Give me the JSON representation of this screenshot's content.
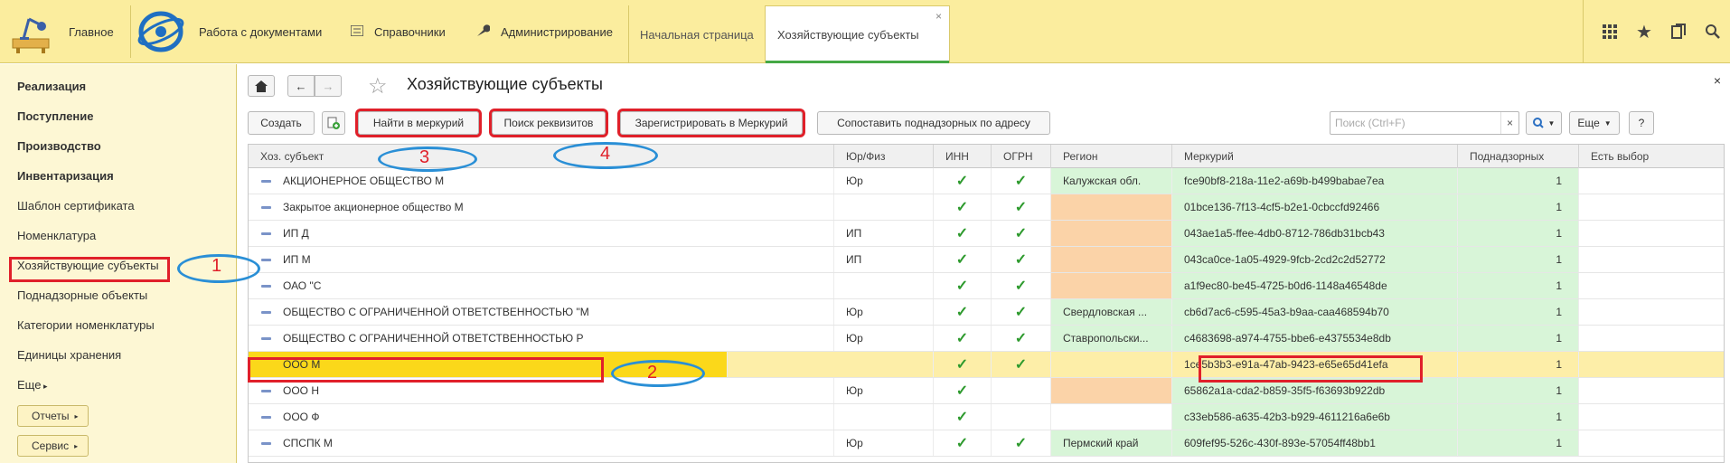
{
  "topbar": {
    "home_label": "Главное",
    "menu": [
      {
        "label": "Работа с документами",
        "icon": "none"
      },
      {
        "label": "Справочники",
        "icon": "list-icon"
      },
      {
        "label": "Администрирование",
        "icon": "wrench-icon"
      }
    ],
    "tabs": [
      {
        "label": "Начальная страница",
        "active": false
      },
      {
        "label": "Хозяйствующие субъекты",
        "active": true,
        "close": "×"
      }
    ],
    "right_icons": [
      "grid-icon",
      "star-icon",
      "history-icon",
      "search-icon"
    ]
  },
  "sidebar": {
    "items": [
      {
        "label": "Реализация",
        "bold": true
      },
      {
        "label": "Поступление",
        "bold": true
      },
      {
        "label": "Производство",
        "bold": true
      },
      {
        "label": "Инвентаризация",
        "bold": true
      },
      {
        "label": "Шаблон сертификата",
        "bold": false
      },
      {
        "label": "Номенклатура",
        "bold": false
      },
      {
        "label": "Хозяйствующие субъекты",
        "bold": false
      },
      {
        "label": "Поднадзорные объекты",
        "bold": false
      },
      {
        "label": "Категории номенклатуры",
        "bold": false
      },
      {
        "label": "Единицы хранения",
        "bold": false
      },
      {
        "label": "Еще",
        "bold": false
      }
    ],
    "buttons": [
      {
        "label": "Отчеты"
      },
      {
        "label": "Сервис"
      }
    ]
  },
  "content": {
    "title": "Хозяйствующие субъекты",
    "close": "×",
    "toolbar": {
      "create": "Создать",
      "find_mercury": "Найти в меркурий",
      "search_requisites": "Поиск реквизитов",
      "register_mercury": "Зарегистрировать в Меркурий",
      "match_supervised": "Сопоставить поднадзорных по адресу",
      "search_placeholder": "Поиск (Ctrl+F)",
      "more": "Еще",
      "help": "?"
    },
    "columns": [
      "Хоз. субъект",
      "Юр/Физ",
      "ИНН",
      "ОГРН",
      "Регион",
      "Меркурий",
      "Поднадзорных",
      "Есть выбор"
    ],
    "rows": [
      {
        "name": "АКЦИОНЕРНОЕ ОБЩЕСТВО  М",
        "type": "Юр",
        "inn": true,
        "ogrn": true,
        "region": "Калужская обл.",
        "region_color": "green",
        "mercury": "fce90bf8-218a-11e2-a69b-b499babae7ea",
        "supervised": "1"
      },
      {
        "name": "Закрытое акционерное общество  М",
        "type": "",
        "inn": true,
        "ogrn": true,
        "region": "",
        "region_color": "orange",
        "mercury": "01bce136-7f13-4cf5-b2e1-0cbccfd92466",
        "supervised": "1"
      },
      {
        "name": "ИП Д",
        "type": "ИП",
        "inn": true,
        "ogrn": true,
        "region": "",
        "region_color": "orange",
        "mercury": "043ae1a5-ffee-4db0-8712-786db31bcb43",
        "supervised": "1"
      },
      {
        "name": "ИП М",
        "type": "ИП",
        "inn": true,
        "ogrn": true,
        "region": "",
        "region_color": "orange",
        "mercury": "043ca0ce-1a05-4929-9fcb-2cd2c2d52772",
        "supervised": "1"
      },
      {
        "name": "ОАО \"С",
        "type": "",
        "inn": true,
        "ogrn": true,
        "region": "",
        "region_color": "orange",
        "mercury": "a1f9ec80-be45-4725-b0d6-1148a46548de",
        "supervised": "1"
      },
      {
        "name": "ОБЩЕСТВО С ОГРАНИЧЕННОЙ ОТВЕТСТВЕННОСТЬЮ \"М",
        "type": "Юр",
        "inn": true,
        "ogrn": true,
        "region": "Свердловская ...",
        "region_color": "green",
        "mercury": "cb6d7ac6-c595-45a3-b9aa-caa468594b70",
        "supervised": "1"
      },
      {
        "name": "ОБЩЕСТВО С ОГРАНИЧЕННОЙ ОТВЕТСТВЕННОСТЬЮ  Р",
        "type": "Юр",
        "inn": true,
        "ogrn": true,
        "region": "Ставропольски...",
        "region_color": "green",
        "mercury": "c4683698-a974-4755-bbe6-e4375534e8db",
        "supervised": "1"
      },
      {
        "name": "ООО   М",
        "type": "",
        "inn": true,
        "ogrn": true,
        "region": "",
        "region_color": "none",
        "mercury": "1ce5b3b3-e91a-47ab-9423-e65e65d41efa",
        "supervised": "1",
        "selected": true
      },
      {
        "name": "ООО  Н",
        "type": "Юр",
        "inn": true,
        "ogrn": false,
        "region": "",
        "region_color": "orange",
        "mercury": "65862a1a-cda2-b859-35f5-f63693b922db",
        "supervised": "1"
      },
      {
        "name": "ООО Ф",
        "type": "",
        "inn": true,
        "ogrn": false,
        "region": "",
        "region_color": "none",
        "mercury": "c33eb586-a635-42b3-b929-4611216a6e6b",
        "supervised": "1"
      },
      {
        "name": "СПСПК  М",
        "type": "Юр",
        "inn": true,
        "ogrn": true,
        "region": "Пермский край",
        "region_color": "green",
        "mercury": "609fef95-526c-430f-893e-57054ff48bb1",
        "supervised": "1"
      }
    ]
  },
  "annotations": [
    "1",
    "2",
    "3",
    "4"
  ],
  "colors": {
    "topbar_bg": "#fbed9e",
    "sidebar_bg": "#fdf7d4",
    "selected_row": "#fdeea8",
    "green_cell": "#d8f5d8",
    "orange_cell": "#fbd3a8",
    "annotation_red": "#e0202a",
    "annotation_blue": "#2a8fd6",
    "check_green": "#2d9a2d"
  }
}
